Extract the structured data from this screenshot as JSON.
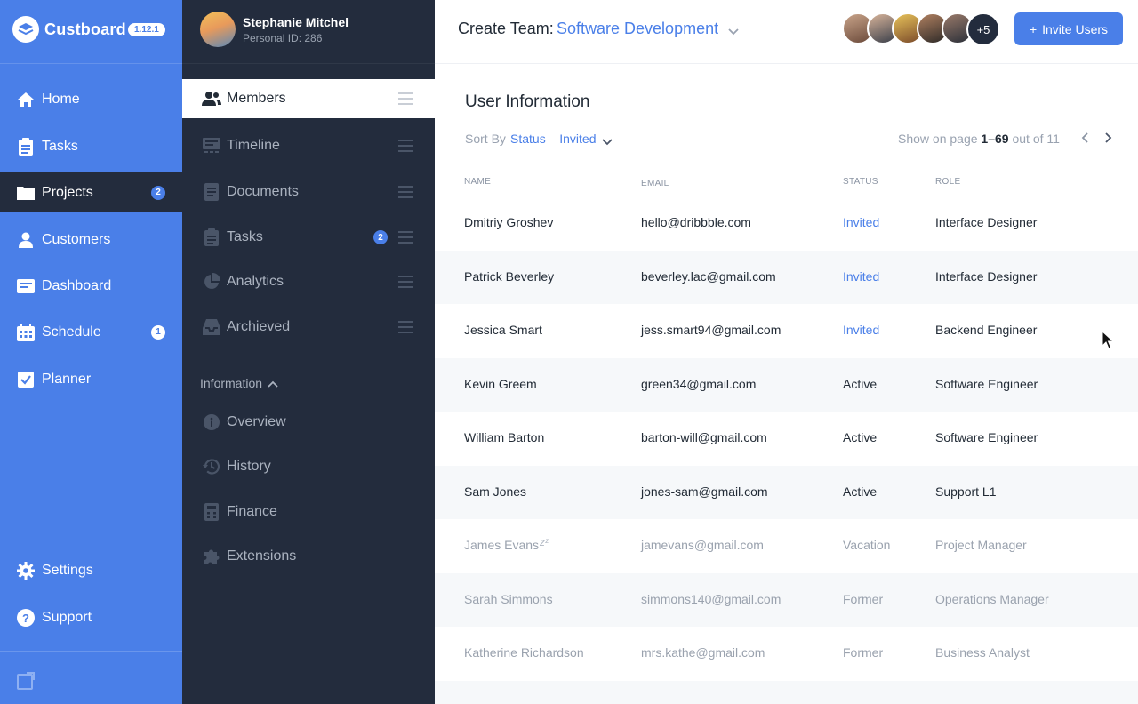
{
  "app": {
    "name": "Custboard",
    "version": "1.12.1"
  },
  "sidebar": {
    "items": [
      {
        "label": "Home",
        "icon": "home-icon"
      },
      {
        "label": "Tasks",
        "icon": "clipboard-icon"
      },
      {
        "label": "Projects",
        "icon": "folder-icon",
        "badge": "2",
        "active": true
      },
      {
        "label": "Customers",
        "icon": "user-icon"
      },
      {
        "label": "Dashboard",
        "icon": "dashboard-icon"
      },
      {
        "label": "Schedule",
        "icon": "calendar-icon",
        "badge": "1"
      },
      {
        "label": "Planner",
        "icon": "checkbox-icon"
      }
    ],
    "bottom": [
      {
        "label": "Settings",
        "icon": "gear-icon"
      },
      {
        "label": "Support",
        "icon": "help-icon"
      }
    ]
  },
  "user": {
    "name": "Stephanie Mitchel",
    "personal_id": "Personal ID: 286"
  },
  "subnav": {
    "items": [
      {
        "label": "Members",
        "icon": "members-icon",
        "active": true
      },
      {
        "label": "Timeline",
        "icon": "timeline-icon"
      },
      {
        "label": "Documents",
        "icon": "document-icon"
      },
      {
        "label": "Tasks",
        "icon": "clipboard-icon",
        "badge": "2"
      },
      {
        "label": "Analytics",
        "icon": "pie-chart-icon"
      },
      {
        "label": "Archieved",
        "icon": "archive-icon"
      }
    ],
    "section_title": "Information",
    "info_items": [
      {
        "label": "Overview",
        "icon": "info-icon"
      },
      {
        "label": "History",
        "icon": "history-icon"
      },
      {
        "label": "Finance",
        "icon": "calculator-icon"
      },
      {
        "label": "Extensions",
        "icon": "puzzle-icon"
      }
    ]
  },
  "header": {
    "create_label": "Create Team:",
    "team_name": "Software Development",
    "more_members": "+5",
    "invite_button": "Invite Users"
  },
  "main": {
    "title": "User Information",
    "sort_label": "Sort By",
    "sort_value": "Status – Invited",
    "pager_prefix": "Show on page",
    "pager_range": "1–69",
    "pager_suffix": "out of 11",
    "columns": [
      "NAME",
      "EMAIL",
      "STATUS",
      "ROLE"
    ],
    "rows": [
      {
        "name": "Dmitriy Groshev",
        "email": "hello@dribbble.com",
        "status": "Invited",
        "role": "Interface Designer"
      },
      {
        "name": "Patrick Beverley",
        "email": "beverley.lac@gmail.com",
        "status": "Invited",
        "role": "Interface Designer"
      },
      {
        "name": "Jessica Smart",
        "email": "jess.smart94@gmail.com",
        "status": "Invited",
        "role": "Backend Engineer"
      },
      {
        "name": "Kevin Greem",
        "email": "green34@gmail.com",
        "status": "Active",
        "role": "Software Engineer"
      },
      {
        "name": "William Barton",
        "email": "barton-will@gmail.com",
        "status": "Active",
        "role": "Software Engineer"
      },
      {
        "name": "Sam Jones",
        "email": "jones-sam@gmail.com",
        "status": "Active",
        "role": "Support L1"
      },
      {
        "name": "James Evans",
        "email": "jamevans@gmail.com",
        "status": "Vacation",
        "role": "Project Manager"
      },
      {
        "name": "Sarah Simmons",
        "email": "simmons140@gmail.com",
        "status": "Former",
        "role": "Operations Manager"
      },
      {
        "name": "Katherine Richardson",
        "email": "mrs.kathe@gmail.com",
        "status": "Former",
        "role": "Business Analyst"
      }
    ]
  },
  "colors": {
    "accent": "#4a7fe8",
    "dark": "#232c3d"
  }
}
